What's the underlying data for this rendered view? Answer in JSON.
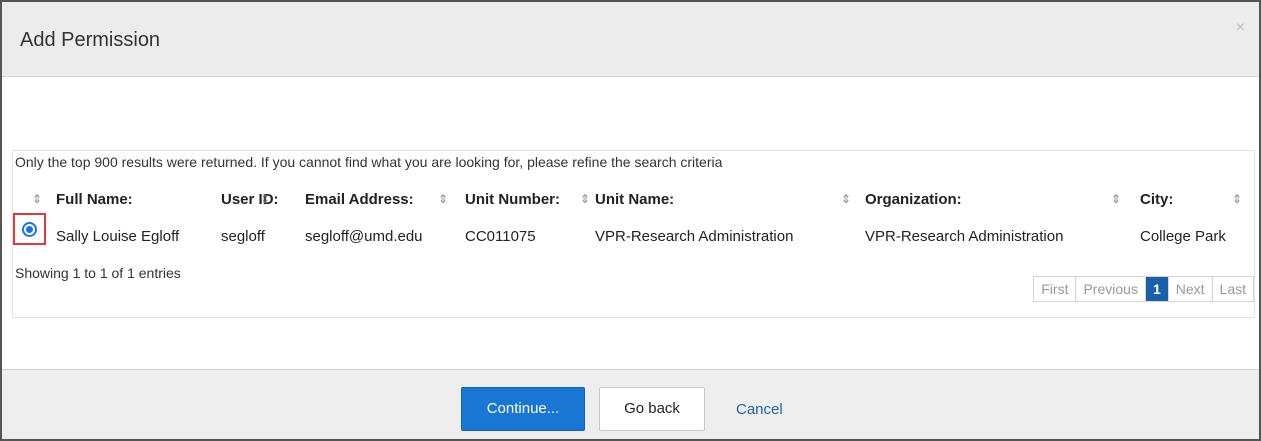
{
  "dialog": {
    "title": "Add Permission",
    "close_symbol": "×"
  },
  "results": {
    "notice": "Only the top 900 results were returned. If you cannot find what you are looking for, please refine the search criteria",
    "columns": {
      "full_name": "Full Name:",
      "user_id": "User ID:",
      "email": "Email Address:",
      "unit_number": "Unit Number:",
      "unit_name": "Unit Name:",
      "organization": "Organization:",
      "city": "City:"
    },
    "sort_symbol": "⇕",
    "rows": [
      {
        "selected": true,
        "full_name": "Sally Louise Egloff",
        "user_id": "segloff",
        "email": "segloff@umd.edu",
        "unit_number": "CC011075",
        "unit_name": "VPR-Research Administration",
        "organization": "VPR-Research Administration",
        "city": "College Park"
      }
    ],
    "info": "Showing 1 to 1 of 1 entries",
    "pagination": {
      "first": "First",
      "previous": "Previous",
      "current": "1",
      "next": "Next",
      "last": "Last"
    }
  },
  "footer": {
    "continue_label": "Continue...",
    "go_back_label": "Go back",
    "cancel_label": "Cancel"
  },
  "colors": {
    "primary": "#1976d2",
    "link": "#1e63b8",
    "highlight": "#e0393e",
    "pager_active": "#1a5faa"
  },
  "icons": {
    "close": "close-icon",
    "sort": "sort-icon",
    "radio": "radio-selected"
  }
}
